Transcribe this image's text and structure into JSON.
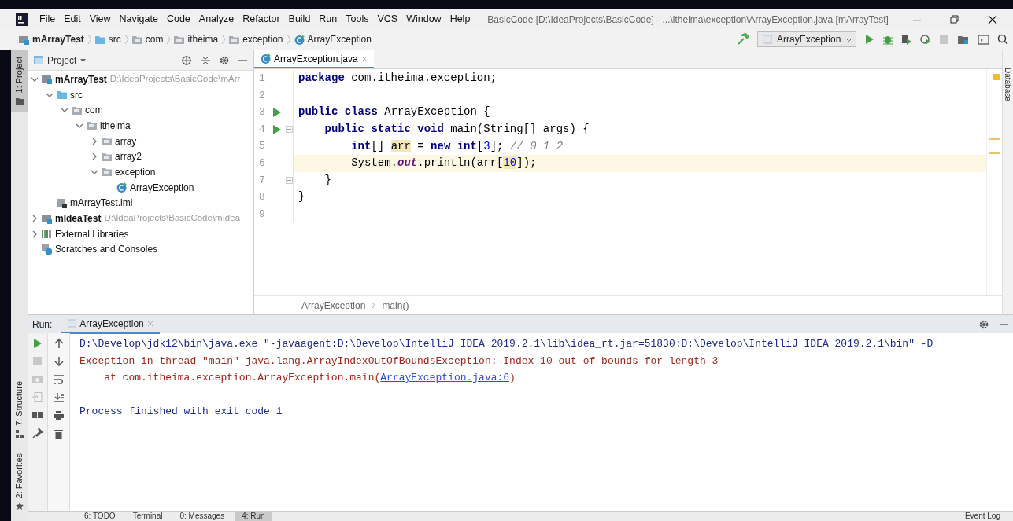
{
  "window": {
    "title": "BasicCode [D:\\IdeaProjects\\BasicCode] - ...\\itheima\\exception\\ArrayException.java [mArrayTest]"
  },
  "menu": [
    "File",
    "Edit",
    "View",
    "Navigate",
    "Code",
    "Analyze",
    "Refactor",
    "Build",
    "Run",
    "Tools",
    "VCS",
    "Window",
    "Help"
  ],
  "breadcrumbs": [
    {
      "label": "mArrayTest",
      "kind": "module"
    },
    {
      "label": "src",
      "kind": "source"
    },
    {
      "label": "com",
      "kind": "package"
    },
    {
      "label": "itheima",
      "kind": "package"
    },
    {
      "label": "exception",
      "kind": "package"
    },
    {
      "label": "ArrayException",
      "kind": "class"
    }
  ],
  "run_config": {
    "label": "ArrayException"
  },
  "side_stripe": {
    "left_top": "1: Project",
    "left_bottom": [
      "7: Structure",
      "2: Favorites"
    ],
    "right": "Database"
  },
  "project": {
    "title": "Project",
    "tree": [
      {
        "label": "mArrayTest",
        "path": "D:\\IdeaProjects\\BasicCode\\mArr",
        "kind": "module",
        "expanded": true,
        "children": [
          {
            "label": "src",
            "kind": "source",
            "expanded": true,
            "children": [
              {
                "label": "com",
                "kind": "package",
                "expanded": true,
                "children": [
                  {
                    "label": "itheima",
                    "kind": "package",
                    "expanded": true,
                    "children": [
                      {
                        "label": "array",
                        "kind": "package",
                        "expanded": false
                      },
                      {
                        "label": "array2",
                        "kind": "package",
                        "expanded": false
                      },
                      {
                        "label": "exception",
                        "kind": "package",
                        "expanded": true,
                        "children": [
                          {
                            "label": "ArrayException",
                            "kind": "class"
                          }
                        ]
                      }
                    ]
                  }
                ]
              }
            ]
          },
          {
            "label": "mArrayTest.iml",
            "kind": "file"
          }
        ]
      },
      {
        "label": "mIdeaTest",
        "path": "D:\\IdeaProjects\\BasicCode\\mIdea",
        "kind": "module",
        "expanded": false
      },
      {
        "label": "External Libraries",
        "kind": "libraries",
        "expanded": false
      },
      {
        "label": "Scratches and Consoles",
        "kind": "scratches"
      }
    ]
  },
  "editor": {
    "tab": {
      "label": "ArrayException.java",
      "selected": true
    },
    "lines": [
      {
        "number": "1",
        "tokens": [
          {
            "text": "package",
            "kind": "keyword"
          },
          {
            "text": " com.itheima.exception;",
            "kind": "plain"
          }
        ]
      },
      {
        "number": "2"
      },
      {
        "number": "3",
        "run": true,
        "tokens": [
          {
            "text": "public class",
            "kind": "keyword"
          },
          {
            "text": " ArrayException {",
            "kind": "plain"
          }
        ]
      },
      {
        "number": "4",
        "run": true,
        "fold": true,
        "tokens": [
          {
            "text": "    public static void",
            "kind": "keyword"
          },
          {
            "text": " main(String[] args) {",
            "kind": "plain"
          }
        ]
      },
      {
        "number": "5",
        "tokens": [
          {
            "text": "        int",
            "kind": "keyword"
          },
          {
            "text": "[] ",
            "kind": "plain"
          },
          {
            "text": "arr",
            "kind": "highlight"
          },
          {
            "text": " = ",
            "kind": "plain"
          },
          {
            "text": "new int",
            "kind": "keyword"
          },
          {
            "text": "[",
            "kind": "plain"
          },
          {
            "text": "3",
            "kind": "number"
          },
          {
            "text": "]; ",
            "kind": "plain"
          },
          {
            "text": "// 0 1 2",
            "kind": "comment"
          }
        ]
      },
      {
        "number": "6",
        "current": true,
        "tokens": [
          {
            "text": "        System.",
            "kind": "plain"
          },
          {
            "text": "out",
            "kind": "static"
          },
          {
            "text": ".println(arr[",
            "kind": "plain"
          },
          {
            "text": "10",
            "kind": "number_highlight"
          },
          {
            "text": "]);",
            "kind": "plain"
          }
        ]
      },
      {
        "number": "7",
        "fold": true,
        "tokens": [
          {
            "text": "    }",
            "kind": "plain"
          }
        ]
      },
      {
        "number": "8",
        "tokens": [
          {
            "text": "}",
            "kind": "plain"
          }
        ]
      },
      {
        "number": "9"
      }
    ],
    "breadcrumbs": [
      "ArrayException",
      "main()"
    ]
  },
  "run": {
    "label": "Run:",
    "tab": {
      "label": "ArrayException",
      "selected": true
    },
    "console": [
      {
        "kind": "command",
        "parts": [
          {
            "text": "D:\\Develop\\jdk12\\bin\\java.exe \"-javaagent:D:\\Develop\\IntelliJ IDEA 2019.2.1\\lib\\idea_rt.jar=51830:D:\\Develop\\IntelliJ IDEA 2019.2.1\\bin\" -D"
          }
        ]
      },
      {
        "kind": "error",
        "parts": [
          {
            "text": "Exception in thread \"main\" java.lang.ArrayIndexOutOfBoundsException: Index 10 out of bounds for length 3"
          }
        ]
      },
      {
        "kind": "error",
        "parts": [
          {
            "text": "    at com.itheima.exception.ArrayException.main("
          },
          {
            "text": "ArrayException.java:6",
            "link": true
          },
          {
            "text": ")"
          }
        ]
      },
      {
        "kind": "blank"
      },
      {
        "kind": "info",
        "parts": [
          {
            "text": "Process finished with exit code 1"
          }
        ]
      }
    ]
  },
  "status_bar": {
    "tabs": [
      {
        "label": "6: TODO",
        "selected": false
      },
      {
        "label": "Terminal",
        "selected": false
      },
      {
        "label": "0: Messages",
        "selected": false
      },
      {
        "label": "4: Run",
        "selected": true
      }
    ],
    "right": "Event Log"
  }
}
